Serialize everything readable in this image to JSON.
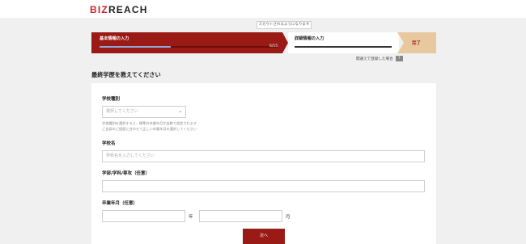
{
  "header": {
    "logo_biz": "BIZ",
    "logo_reach": "REACH"
  },
  "scout_note": "スカウトされるようになります",
  "steps": {
    "step1": {
      "label": "基本情報の入力",
      "count": "6/15",
      "progress": 0.4
    },
    "step2": {
      "label": "詳細情報の入力"
    },
    "step3": {
      "label": "完了"
    }
  },
  "mistake_link": {
    "text": "間違えて登録した場合",
    "badge": "?"
  },
  "page_heading": "最終学歴を教えてください",
  "form": {
    "school_type": {
      "label": "学校種別",
      "placeholder": "選択してください",
      "help_line1": "学校種別を選択すると、標準の卒業年月が自動で設定されます",
      "help_line2": "ご自身のご経歴に合わせて正しい卒業年月を選択してください"
    },
    "school_name": {
      "label": "学校名",
      "placeholder": "学校名を入力してください"
    },
    "department": {
      "label": "学部/学科/専攻（任意）",
      "placeholder": ""
    },
    "graduation": {
      "label": "卒業年月（任意）",
      "year_unit": "年",
      "month_unit": "月"
    },
    "next_label": "次へ"
  },
  "colors": {
    "brand_red": "#9a1b15",
    "complete_bg": "#e8c99f",
    "progress_fill": "#8fa6d8"
  }
}
